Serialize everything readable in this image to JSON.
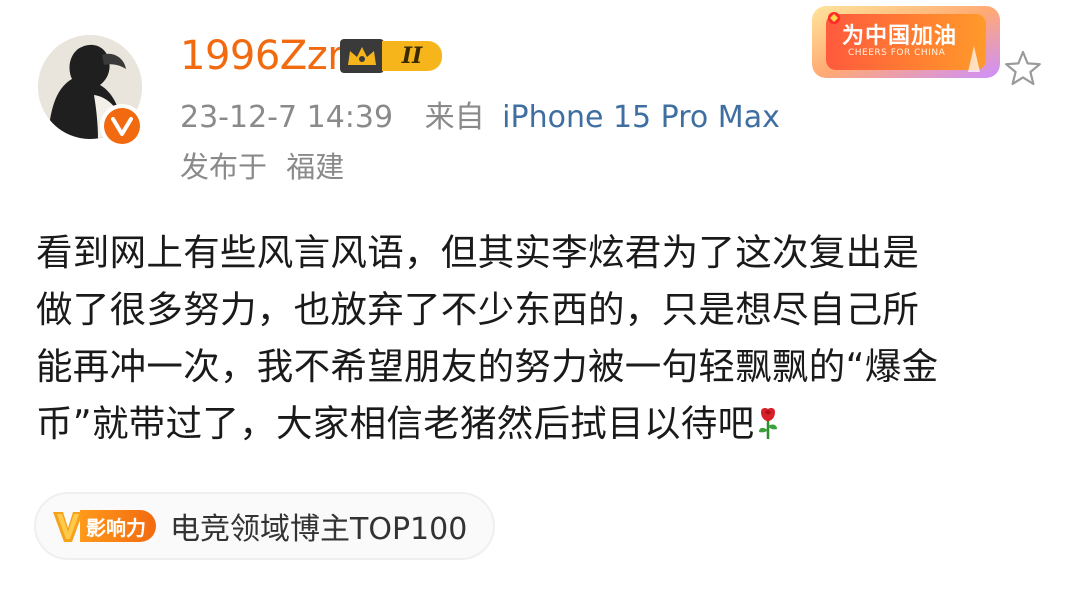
{
  "post": {
    "username": "1996Zzr",
    "member_level": "II",
    "timestamp": "23-12-7 14:39",
    "source_prefix": "来自",
    "device": "iPhone 15 Pro Max",
    "location_label": "发布于",
    "location_name": "福建",
    "content_lines": [
      "看到网上有些风言风语，但其实李炫君为了这次复出是",
      "做了很多努力，也放弃了不少东西的，只是想尽自己所",
      "能再冲一次，我不希望朋友的努力被一句轻飘飘的“爆金",
      "币”就带过了，大家相信老猪然后拭目以待吧"
    ],
    "content_emoji": "rose-icon",
    "influence_badge": "影响力",
    "influence_tag": "电竞领域博主TOP100"
  },
  "event_badge": {
    "title": "为中国加油",
    "subtitle": "CHEERS FOR CHINA"
  },
  "icons": {
    "verified": "verified-v-icon",
    "crown": "crown-icon",
    "favorite": "star-icon",
    "rose": "rose-icon"
  },
  "colors": {
    "accent": "#f26a10",
    "link": "#3f6fa0",
    "meta": "#8a8a8a",
    "gold": "#f5b51b"
  }
}
